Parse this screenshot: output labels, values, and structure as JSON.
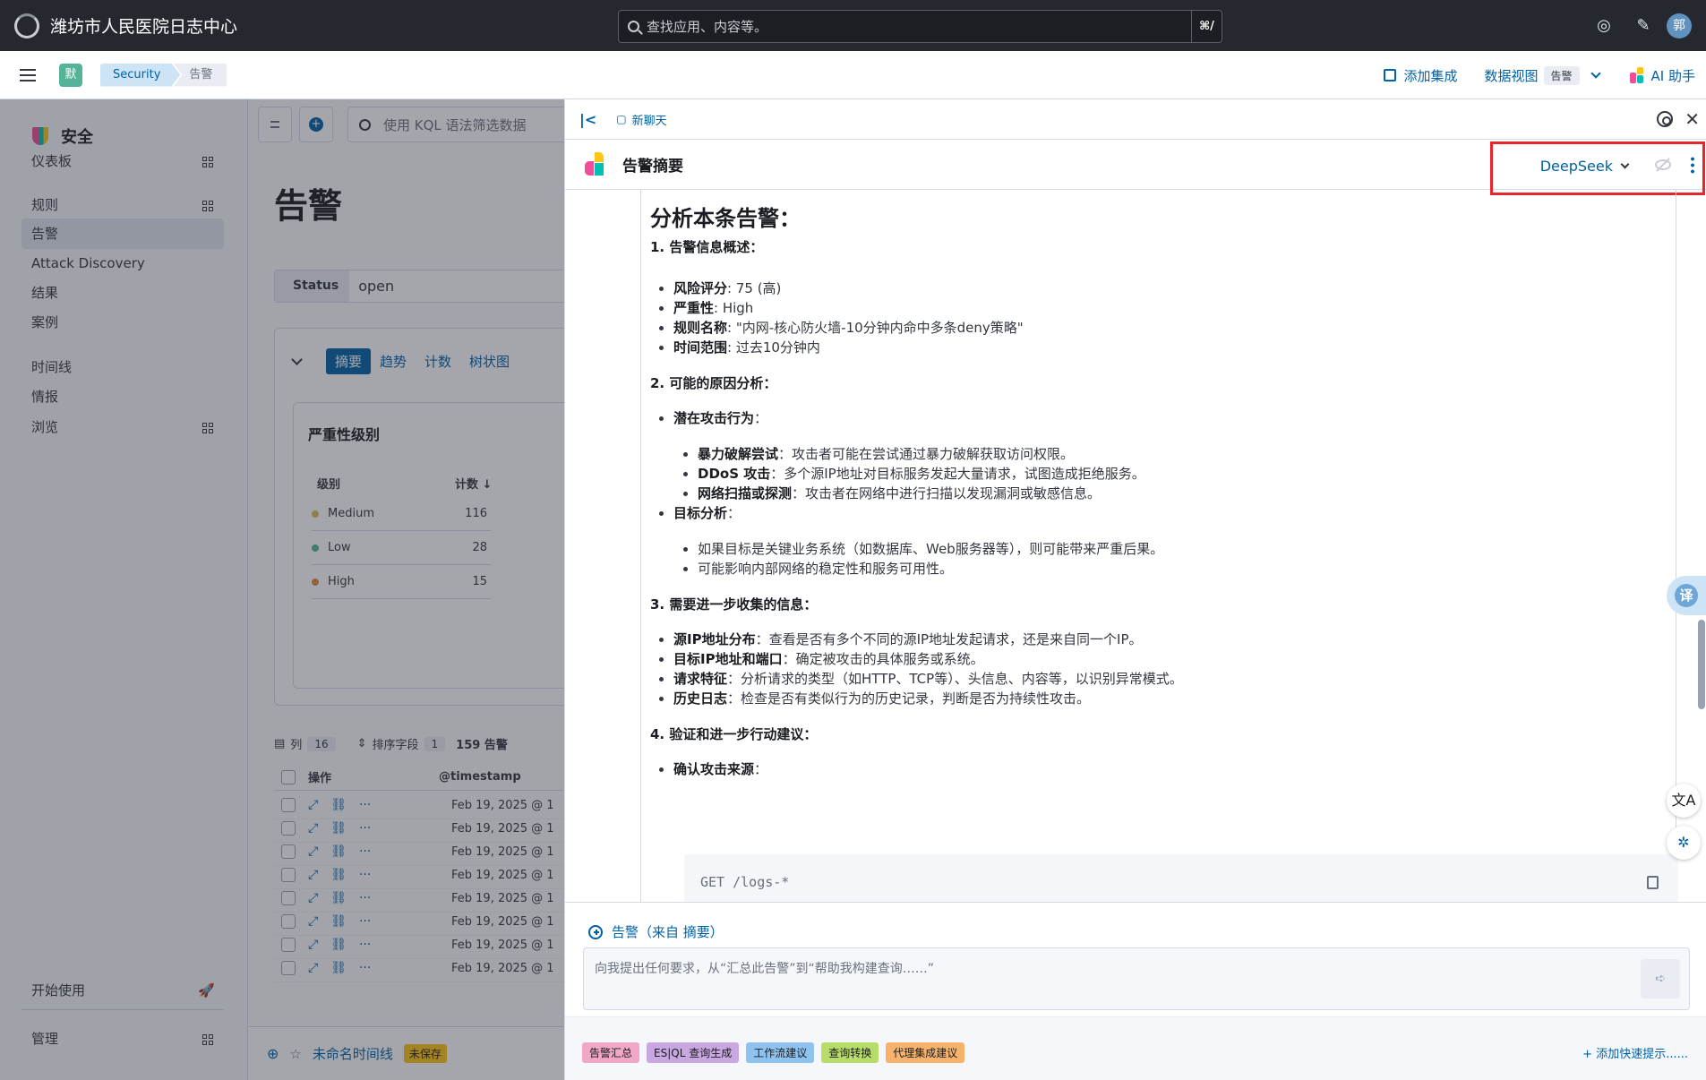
{
  "header": {
    "app_title": "潍坊市人民医院日志中心",
    "search_placeholder": "查找应用、内容等。",
    "search_shortcut": "⌘/",
    "avatar_initial": "郭"
  },
  "subbar": {
    "space_initial": "默",
    "breadcrumbs": [
      "Security",
      "告警"
    ],
    "add_integration": "添加集成",
    "data_view_label": "数据视图",
    "data_view_value": "告警",
    "ai_assistant": "AI 助手"
  },
  "sidenav": {
    "title": "安全",
    "items": [
      {
        "label": "仪表板",
        "grid": true
      },
      {
        "label": "规则",
        "grid": true
      },
      {
        "label": "告警",
        "grid": false,
        "active": true
      },
      {
        "label": "Attack Discovery",
        "grid": false
      },
      {
        "label": "结果",
        "grid": false
      },
      {
        "label": "案例",
        "grid": false
      },
      {
        "label": "时间线",
        "grid": false
      },
      {
        "label": "情报",
        "grid": false
      },
      {
        "label": "浏览",
        "grid": true
      }
    ],
    "get_started": "开始使用",
    "manage": "管理"
  },
  "main": {
    "kql_placeholder": "使用 KQL 语法筛选数据",
    "page_title": "告警",
    "status_key": "Status",
    "status_value": "open",
    "tabs": [
      "摘要",
      "趋势",
      "计数",
      "树状图"
    ],
    "severity_title": "严重性级别",
    "severity_headers": [
      "级别",
      "计数"
    ],
    "severity_rows": [
      {
        "label": "Medium",
        "count": "116",
        "color": "#d6bf57"
      },
      {
        "label": "Low",
        "count": "28",
        "color": "#54b399"
      },
      {
        "label": "High",
        "count": "15",
        "color": "#da8b45"
      }
    ],
    "table_meta": {
      "columns_label": "列",
      "columns_count": "16",
      "sort_label": "排序字段",
      "sort_count": "1",
      "alerts_count": "159 告警"
    },
    "table_headers": [
      "操作",
      "@timestamp"
    ],
    "row_timestamp": "Feb 19, 2025 @ 1",
    "timeline_name": "未命名时间线",
    "timeline_status": "未保存"
  },
  "flyout": {
    "new_chat": "新聊天",
    "title": "告警摘要",
    "connector": "DeepSeek",
    "heading": "分析本条告警：",
    "sec1": "1. 告警信息概述：",
    "sec1_items": [
      {
        "k": "风险评分",
        "v": ": 75 (高)"
      },
      {
        "k": "严重性",
        "v": ": High"
      },
      {
        "k": "规则名称",
        "v": ": \"内网-核心防火墙-10分钟内命中多条deny策略\""
      },
      {
        "k": "时间范围",
        "v": ": 过去10分钟内"
      }
    ],
    "sec2": "2. 可能的原因分析：",
    "sec2_a": "潜在攻击行为",
    "sec2_a_items": [
      {
        "k": "暴力破解尝试",
        "v": "：攻击者可能在尝试通过暴力破解获取访问权限。"
      },
      {
        "k": "DDoS 攻击",
        "v": "：多个源IP地址对目标服务发起大量请求，试图造成拒绝服务。"
      },
      {
        "k": "网络扫描或探测",
        "v": "：攻击者在网络中进行扫描以发现漏洞或敏感信息。"
      }
    ],
    "sec2_b": "目标分析",
    "sec2_b_items": [
      "如果目标是关键业务系统（如数据库、Web服务器等），则可能带来严重后果。",
      "可能影响内部网络的稳定性和服务可用性。"
    ],
    "sec3": "3. 需要进一步收集的信息：",
    "sec3_items": [
      {
        "k": "源IP地址分布",
        "v": "：查看是否有多个不同的源IP地址发起请求，还是来自同一个IP。"
      },
      {
        "k": "目标IP地址和端口",
        "v": "：确定被攻击的具体服务或系统。"
      },
      {
        "k": "请求特征",
        "v": "：分析请求的类型（如HTTP、TCP等）、头信息、内容等，以识别异常模式。"
      },
      {
        "k": "历史日志",
        "v": "：检查是否有类似行为的历史记录，判断是否为持续性攻击。"
      }
    ],
    "sec4": "4. 验证和进一步行动建议：",
    "sec4_a": "确认攻击来源",
    "code": "GET /logs-*",
    "translate": "译",
    "context": "告警（来自 摘要）",
    "prompt_placeholder": "向我提出任何要求，从“汇总此告警”到“帮助我构建查询……”",
    "quick_prompts": [
      {
        "label": "告警汇总",
        "color": "#f1a7c6"
      },
      {
        "label": "ES|QL 查询生成",
        "color": "#c9a7e0"
      },
      {
        "label": "工作流建议",
        "color": "#8fc3ef"
      },
      {
        "label": "查询转换",
        "color": "#b7dc6a"
      },
      {
        "label": "代理集成建议",
        "color": "#f7b36b"
      }
    ],
    "add_quick_prompt": "+ 添加快速提示......"
  }
}
